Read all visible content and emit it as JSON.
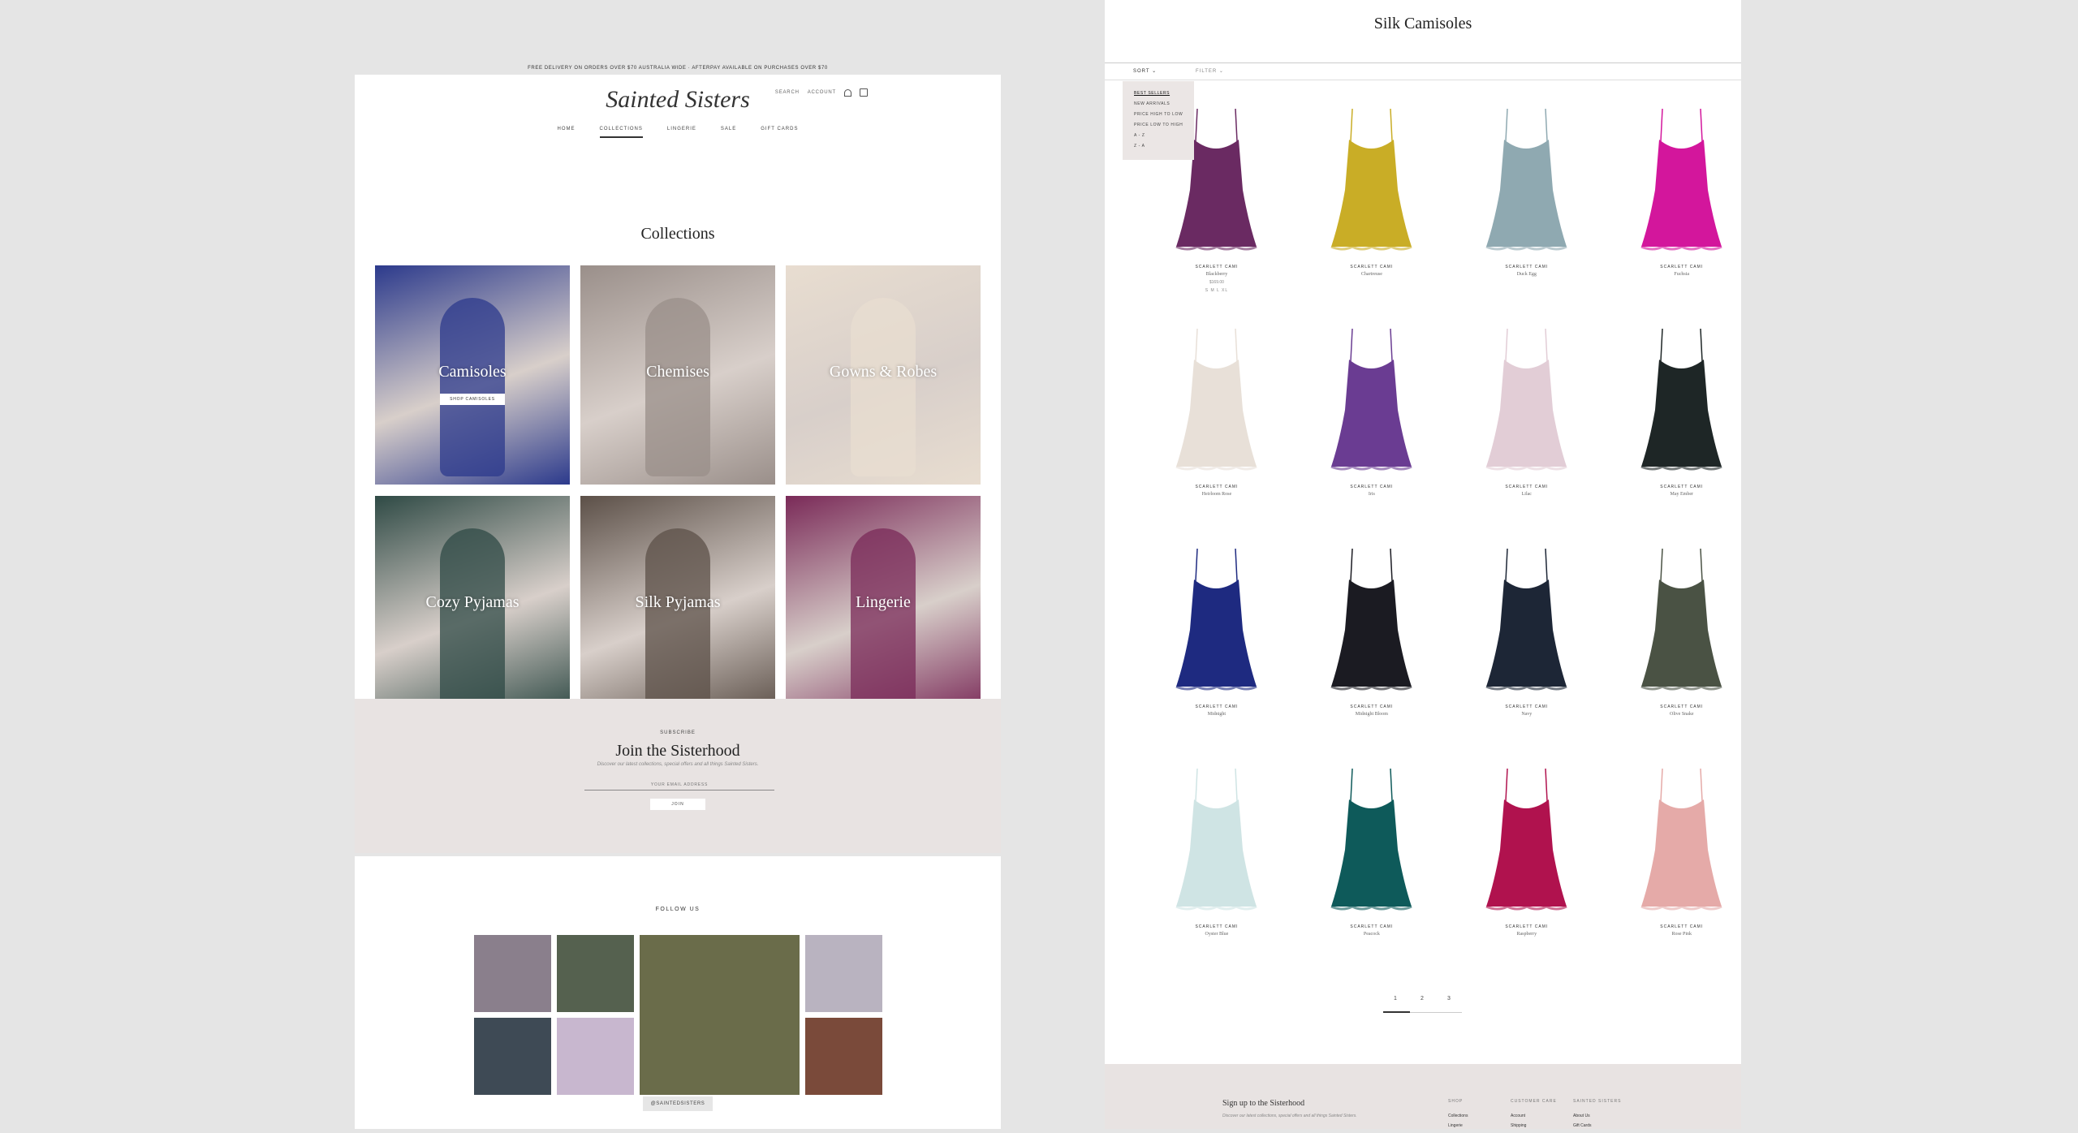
{
  "left_page": {
    "promo_text": "FREE DELIVERY ON ORDERS OVER $70 AUSTRALIA WIDE  ·  AFTERPAY AVAILABLE ON PURCHASES OVER $70",
    "brand": "Sainted Sisters",
    "header_links": {
      "search": "SEARCH",
      "account": "ACCOUNT",
      "wishlist_icon": "heart-icon",
      "cart_icon": "bag-icon"
    },
    "nav": [
      "HOME",
      "COLLECTIONS",
      "LINGERIE",
      "SALE",
      "GIFT CARDS"
    ],
    "nav_active": "COLLECTIONS",
    "collections_title": "Collections",
    "collections": [
      {
        "name": "Camisoles",
        "button": "SHOP CAMISOLES",
        "color": "#2c3a8c"
      },
      {
        "name": "Chemises",
        "color": "#9a8f8a"
      },
      {
        "name": "Gowns & Robes",
        "color": "#e8ddd0"
      },
      {
        "name": "Cozy Pyjamas",
        "color": "#2f4a45"
      },
      {
        "name": "Silk Pyjamas",
        "color": "#5c5048"
      },
      {
        "name": "Lingerie",
        "color": "#7a2a58"
      }
    ],
    "subscribe": {
      "kicker": "SUBSCRIBE",
      "title": "Join the Sisterhood",
      "text": "Discover our latest collections, special offers and all things Sainted Sisters.",
      "email_placeholder": "YOUR EMAIL ADDRESS",
      "button": "JOIN"
    },
    "follow": {
      "title": "FOLLOW US",
      "handle": "@SAINTEDSISTERS"
    }
  },
  "right_page": {
    "title": "Silk Camisoles",
    "sort_label": "SORT",
    "filter_label": "FILTER",
    "sort_options": [
      "BEST SELLERS",
      "NEW ARRIVALS",
      "PRICE HIGH TO LOW",
      "PRICE LOW TO HIGH",
      "A - Z",
      "Z - A"
    ],
    "sort_active": "BEST SELLERS",
    "products": [
      {
        "name": "SCARLETT CAMI",
        "color_name": "Blackberry",
        "price": "$169.00",
        "sizes": "S M L XL",
        "swatch": "#6a2a62"
      },
      {
        "name": "SCARLETT CAMI",
        "color_name": "Chartreuse",
        "swatch": "#c9ad26"
      },
      {
        "name": "SCARLETT CAMI",
        "color_name": "Duck Egg",
        "swatch": "#8fa9b1"
      },
      {
        "name": "SCARLETT CAMI",
        "color_name": "Fuchsia",
        "swatch": "#d3169c"
      },
      {
        "name": "SCARLETT CAMI",
        "color_name": "Heirloom Rose",
        "swatch": "#e8e0d8"
      },
      {
        "name": "SCARLETT CAMI",
        "color_name": "Iris",
        "swatch": "#6a3c92"
      },
      {
        "name": "SCARLETT CAMI",
        "color_name": "Lilac",
        "swatch": "#e2cdd6"
      },
      {
        "name": "SCARLETT CAMI",
        "color_name": "May Ember",
        "swatch": "#1e2626"
      },
      {
        "name": "SCARLETT CAMI",
        "color_name": "Midnight",
        "swatch": "#1e2a80"
      },
      {
        "name": "SCARLETT CAMI",
        "color_name": "Midnight Bloom",
        "swatch": "#1b1b22"
      },
      {
        "name": "SCARLETT CAMI",
        "color_name": "Navy",
        "swatch": "#1d2636"
      },
      {
        "name": "SCARLETT CAMI",
        "color_name": "Olive Snake",
        "swatch": "#4a5244"
      },
      {
        "name": "SCARLETT CAMI",
        "color_name": "Oyster Blue",
        "swatch": "#cfe4e4"
      },
      {
        "name": "SCARLETT CAMI",
        "color_name": "Peacock",
        "swatch": "#0e5a5a"
      },
      {
        "name": "SCARLETT CAMI",
        "color_name": "Raspberry",
        "swatch": "#b0124e"
      },
      {
        "name": "SCARLETT CAMI",
        "color_name": "Rose Pink",
        "swatch": "#e5aaa8"
      }
    ],
    "pagination": [
      "1",
      "2",
      "3"
    ],
    "footer": {
      "title": "Sign up to the Sisterhood",
      "text": "Discover our latest collections, special offers and all things Sainted Sisters.",
      "columns": [
        {
          "heading": "SHOP",
          "links": [
            "Collections",
            "Lingerie"
          ]
        },
        {
          "heading": "CUSTOMER CARE",
          "links": [
            "Account",
            "Shipping"
          ]
        },
        {
          "heading": "SAINTED SISTERS",
          "links": [
            "About Us",
            "Gift Cards"
          ]
        }
      ]
    }
  }
}
